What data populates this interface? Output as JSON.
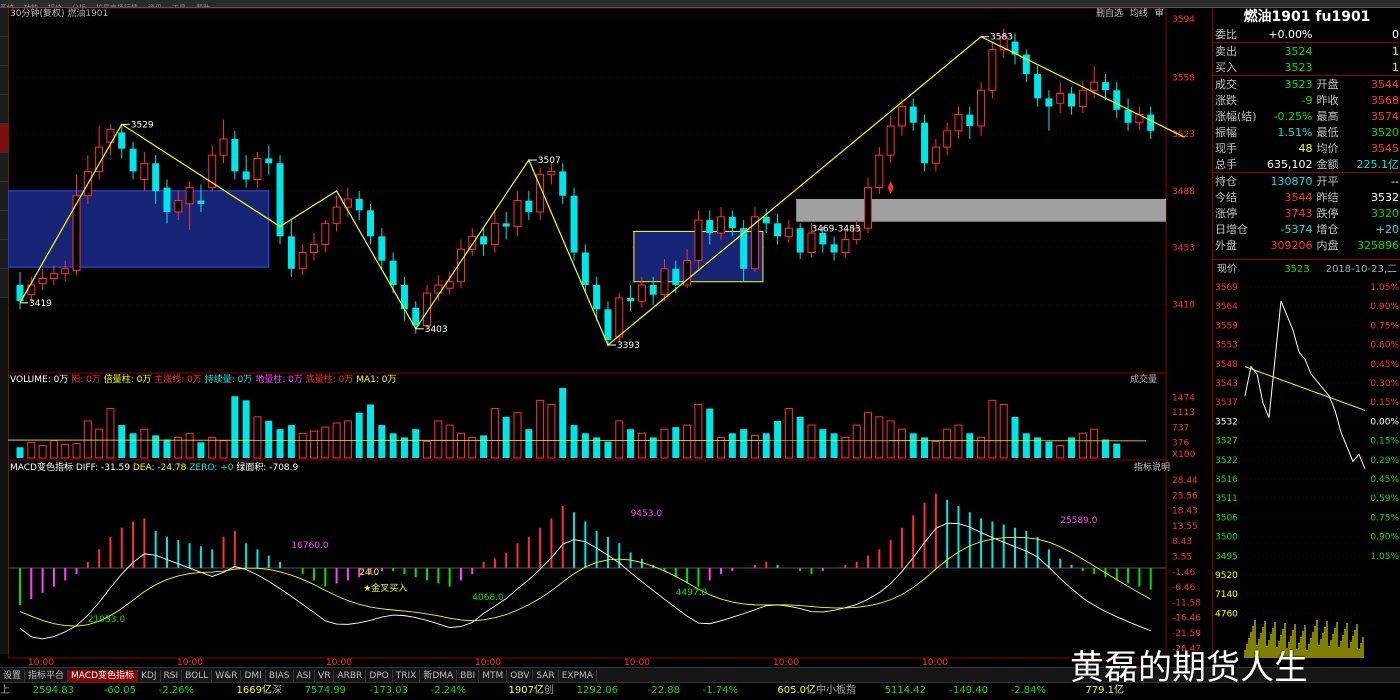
{
  "menubar": [
    "系统",
    "功能",
    "报价",
    "分析",
    "扩展市场行情",
    "资讯",
    "工具",
    "帮助"
  ],
  "chart_header": {
    "period": "30分钟(复权)",
    "name": "燃油1901"
  },
  "chart_top_buttons": [
    "删自选",
    "均线",
    "审"
  ],
  "colors": {
    "up": "#ff3030",
    "down": "#00e6e6",
    "box": "#1a2a8a",
    "trend": "#ffff00",
    "bg": "#000000"
  },
  "price_axis": [
    "3594",
    "3558",
    "3523",
    "3488",
    "3453",
    "3418"
  ],
  "annotations": {
    "peaks": [
      "3419",
      "3529",
      "3403",
      "3507",
      "3393",
      "3583"
    ],
    "range_label": "3469-3483"
  },
  "chart_data": [
    {
      "type": "candlestick",
      "title": "燃油1901 30分钟",
      "ylim": [
        3385,
        3597
      ],
      "yticks": [
        3594,
        3558,
        3523,
        3488,
        3453,
        3418
      ],
      "candles": [
        [
          3430,
          3420,
          3438,
          3415
        ],
        [
          3424,
          3430,
          3435,
          3419
        ],
        [
          3431,
          3434,
          3440,
          3427
        ],
        [
          3434,
          3437,
          3442,
          3430
        ],
        [
          3437,
          3440,
          3445,
          3432
        ],
        [
          3439,
          3485,
          3498,
          3436
        ],
        [
          3485,
          3500,
          3510,
          3480
        ],
        [
          3500,
          3515,
          3528,
          3495
        ],
        [
          3518,
          3526,
          3529,
          3510
        ],
        [
          3524,
          3514,
          3528,
          3508
        ],
        [
          3514,
          3500,
          3518,
          3495
        ],
        [
          3495,
          3505,
          3512,
          3488
        ],
        [
          3505,
          3488,
          3510,
          3480
        ],
        [
          3490,
          3475,
          3495,
          3468
        ],
        [
          3475,
          3482,
          3488,
          3470
        ],
        [
          3480,
          3490,
          3494,
          3464
        ],
        [
          3482,
          3480,
          3492,
          3475
        ],
        [
          3490,
          3510,
          3516,
          3488
        ],
        [
          3510,
          3520,
          3532,
          3505
        ],
        [
          3520,
          3500,
          3525,
          3495
        ],
        [
          3500,
          3495,
          3510,
          3490
        ],
        [
          3495,
          3508,
          3512,
          3490
        ],
        [
          3508,
          3505,
          3516,
          3498
        ],
        [
          3505,
          3460,
          3510,
          3455
        ],
        [
          3460,
          3440,
          3470,
          3435
        ],
        [
          3440,
          3450,
          3455,
          3436
        ],
        [
          3450,
          3455,
          3462,
          3445
        ],
        [
          3455,
          3468,
          3470,
          3450
        ],
        [
          3468,
          3478,
          3485,
          3463
        ],
        [
          3478,
          3483,
          3490,
          3472
        ],
        [
          3483,
          3476,
          3488,
          3470
        ],
        [
          3476,
          3460,
          3480,
          3455
        ],
        [
          3460,
          3445,
          3465,
          3440
        ],
        [
          3445,
          3430,
          3450,
          3425
        ],
        [
          3430,
          3415,
          3435,
          3408
        ],
        [
          3416,
          3405,
          3420,
          3400
        ],
        [
          3405,
          3425,
          3430,
          3402
        ],
        [
          3425,
          3430,
          3436,
          3420
        ],
        [
          3428,
          3432,
          3438,
          3424
        ],
        [
          3432,
          3452,
          3458,
          3428
        ],
        [
          3452,
          3460,
          3465,
          3448
        ],
        [
          3460,
          3455,
          3465,
          3448
        ],
        [
          3455,
          3468,
          3475,
          3450
        ],
        [
          3468,
          3466,
          3475,
          3458
        ],
        [
          3466,
          3482,
          3488,
          3460
        ],
        [
          3482,
          3475,
          3488,
          3470
        ],
        [
          3475,
          3498,
          3502,
          3470
        ],
        [
          3498,
          3500,
          3505,
          3492
        ],
        [
          3500,
          3485,
          3505,
          3480
        ],
        [
          3485,
          3450,
          3490,
          3445
        ],
        [
          3450,
          3430,
          3455,
          3425
        ],
        [
          3430,
          3415,
          3435,
          3408
        ],
        [
          3415,
          3396,
          3420,
          3392
        ],
        [
          3398,
          3422,
          3425,
          3395
        ],
        [
          3422,
          3420,
          3430,
          3414
        ],
        [
          3420,
          3430,
          3435,
          3416
        ],
        [
          3430,
          3424,
          3435,
          3418
        ],
        [
          3424,
          3440,
          3446,
          3420
        ],
        [
          3440,
          3430,
          3445,
          3425
        ],
        [
          3430,
          3445,
          3452,
          3428
        ],
        [
          3445,
          3470,
          3476,
          3440
        ],
        [
          3470,
          3462,
          3476,
          3455
        ],
        [
          3462,
          3472,
          3478,
          3458
        ],
        [
          3472,
          3465,
          3476,
          3460
        ],
        [
          3465,
          3440,
          3470,
          3432
        ],
        [
          3440,
          3472,
          3478,
          3438
        ],
        [
          3472,
          3468,
          3477,
          3462
        ],
        [
          3468,
          3460,
          3474,
          3455
        ],
        [
          3460,
          3465,
          3470,
          3456
        ],
        [
          3465,
          3450,
          3468,
          3446
        ],
        [
          3450,
          3462,
          3468,
          3447
        ],
        [
          3462,
          3455,
          3466,
          3450
        ],
        [
          3455,
          3450,
          3460,
          3445
        ],
        [
          3450,
          3458,
          3464,
          3447
        ],
        [
          3458,
          3465,
          3470,
          3455
        ],
        [
          3465,
          3490,
          3496,
          3462
        ],
        [
          3490,
          3510,
          3515,
          3486
        ],
        [
          3510,
          3528,
          3534,
          3505
        ],
        [
          3528,
          3540,
          3545,
          3522
        ],
        [
          3540,
          3530,
          3545,
          3525
        ],
        [
          3530,
          3505,
          3535,
          3500
        ],
        [
          3505,
          3515,
          3520,
          3500
        ],
        [
          3515,
          3525,
          3530,
          3510
        ],
        [
          3525,
          3535,
          3540,
          3520
        ],
        [
          3535,
          3528,
          3540,
          3520
        ],
        [
          3528,
          3550,
          3555,
          3522
        ],
        [
          3550,
          3575,
          3580,
          3545
        ],
        [
          3575,
          3583,
          3588,
          3570
        ],
        [
          3580,
          3572,
          3585,
          3566
        ],
        [
          3572,
          3560,
          3575,
          3555
        ],
        [
          3560,
          3545,
          3565,
          3540
        ],
        [
          3545,
          3540,
          3550,
          3525
        ],
        [
          3542,
          3548,
          3555,
          3536
        ],
        [
          3548,
          3540,
          3552,
          3535
        ],
        [
          3540,
          3550,
          3556,
          3536
        ],
        [
          3550,
          3555,
          3565,
          3545
        ],
        [
          3555,
          3550,
          3560,
          3544
        ],
        [
          3550,
          3538,
          3555,
          3533
        ],
        [
          3538,
          3530,
          3545,
          3525
        ],
        [
          3530,
          3535,
          3540,
          3526
        ],
        [
          3535,
          3525,
          3540,
          3520
        ]
      ]
    },
    {
      "type": "bar",
      "title": "VOLUME",
      "yticks": [
        "1474",
        "1113",
        "737",
        "376",
        "X100"
      ],
      "values": [
        260,
        380,
        300,
        420,
        330,
        350,
        900,
        700,
        1200,
        800,
        600,
        700,
        550,
        450,
        500,
        600,
        380,
        500,
        420,
        1500,
        1400,
        1000,
        900,
        700,
        800,
        600,
        650,
        750,
        850,
        900,
        1100,
        1300,
        800,
        600,
        500,
        700,
        400,
        900,
        800,
        600,
        500,
        550,
        1200,
        1000,
        1100,
        700,
        1400,
        1300,
        1700,
        800,
        600,
        500,
        400,
        900,
        700,
        600,
        500,
        700,
        750,
        800,
        1300,
        1200,
        500,
        600,
        700,
        550,
        600,
        900,
        1200,
        1000,
        800,
        700,
        600,
        500,
        800,
        1100,
        1000,
        900,
        700,
        600,
        500,
        400,
        700,
        800,
        600,
        500,
        1400,
        1300,
        1000,
        600,
        500,
        400,
        300,
        500,
        600,
        700,
        450,
        350
      ],
      "ma": 376
    },
    {
      "type": "bar",
      "title": "MACD",
      "yticks": [
        "28.44",
        "23.56",
        "18.43",
        "13.55",
        "8.43",
        "3.55",
        "-1.46",
        "-6.46",
        "-11.58",
        "-16.46",
        "-21.59",
        "-26.47"
      ],
      "values": [
        -12,
        -10,
        -8,
        -6,
        -4,
        -2,
        2,
        6,
        10,
        13,
        15,
        16,
        12,
        10,
        9,
        8,
        7,
        6,
        10,
        12,
        8,
        6,
        4,
        2,
        0,
        -2,
        -4,
        -6,
        -5,
        -4,
        -3,
        -2,
        -1,
        -1,
        -2,
        -3,
        -4,
        -5,
        -6,
        -4,
        -2,
        2,
        3,
        5,
        8,
        10,
        13,
        16,
        20,
        18,
        15,
        12,
        10,
        8,
        5,
        3,
        1,
        -1,
        -3,
        -5,
        -6,
        -4,
        -2,
        -1,
        0,
        1,
        2,
        1,
        0,
        -1,
        -2,
        -1,
        0,
        1,
        2,
        4,
        6,
        9,
        13,
        17,
        21,
        24,
        22,
        20,
        18,
        16,
        15,
        14,
        13,
        12,
        10,
        6,
        3,
        1,
        -1,
        -2,
        -3,
        -4,
        -5,
        -6,
        -7,
        -8,
        -9,
        -10
      ],
      "diff_label": "MACD变色指标 DIFF: -31.59",
      "dea_label": "DEA: -24.78",
      "zero_label": "ZERO: +0",
      "area_label": "绿面积: -708.9",
      "area_values": [
        "16760.0",
        "9453.0",
        "25589.0",
        "21933.0",
        "4068.0",
        "4497.0",
        "24.0"
      ]
    }
  ],
  "volume_header": [
    "VOLUME: 0万",
    "阳: 0万",
    "倍量柱: 0万",
    "主涨线: 0万",
    "持续量: 0万",
    "地量柱: 0万",
    "底量柱: 0万",
    "MA1: 0万"
  ],
  "volume_right": "成交量",
  "macd_right": "指标说明",
  "macd_note": "★金叉买入",
  "time_labels": [
    "10:00",
    "10:00",
    "10:00",
    "10:00",
    "10:00",
    "10:00",
    "10:00"
  ],
  "quote": {
    "title": "燃油1901 fu1901",
    "rows": [
      {
        "k": "委比",
        "v1": "+0.00%",
        "v2": "0",
        "c1": "white",
        "c2": "white"
      },
      {
        "k": "卖出",
        "v1": "3524",
        "v2": "1",
        "c1": "green",
        "c2": "yel"
      },
      {
        "k": "买入",
        "v1": "3523",
        "v2": "1",
        "c1": "green",
        "c2": "yel"
      },
      {
        "k": "成交",
        "v1": "3523",
        "k2": "开盘",
        "v2": "3544",
        "c1": "green",
        "c2": "red"
      },
      {
        "k": "涨跌",
        "v1": "-9",
        "k2": "昨收",
        "v2": "3568",
        "c1": "green",
        "c2": "red"
      },
      {
        "k": "涨幅(结)",
        "v1": "-0.25%",
        "k2": "最高",
        "v2": "3574",
        "c1": "green",
        "c2": "red"
      },
      {
        "k": "振幅",
        "v1": "1.51%",
        "k2": "最低",
        "v2": "3520",
        "c1": "cyan",
        "c2": "green"
      },
      {
        "k": "现手",
        "v1": "48",
        "k2": "均价",
        "v2": "3545",
        "c1": "yel",
        "c2": "red"
      },
      {
        "k": "总手",
        "v1": "635,102",
        "k2": "金额",
        "v2": "225.1亿",
        "c1": "white",
        "c2": "cyan"
      },
      {
        "k": "持仓",
        "v1": "130870",
        "k2": "开平",
        "v2": "--",
        "c1": "cyan",
        "c2": "white"
      },
      {
        "k": "今结",
        "v1": "3544",
        "k2": "昨结",
        "v2": "3532",
        "c1": "red",
        "c2": "white"
      },
      {
        "k": "涨停",
        "v1": "3743",
        "k2": "跌停",
        "v2": "3320",
        "c1": "red",
        "c2": "green"
      },
      {
        "k": "日增仓",
        "v1": "-5374",
        "k2": "增仓",
        "v2": "+20",
        "c1": "cyan",
        "c2": "cyan"
      },
      {
        "k": "外盘",
        "v1": "309206",
        "k2": "内盘",
        "v2": "325896",
        "c1": "red",
        "c2": "green"
      }
    ],
    "now_label": "现价",
    "now_value": "3523",
    "now_date": "2018-10-23,二",
    "mini_axis_left": [
      "3569",
      "3564",
      "3559",
      "3553",
      "3548",
      "3543",
      "3537",
      "3532",
      "3527",
      "3522",
      "3516",
      "3511",
      "3506",
      "3500",
      "3495",
      "9520",
      "7140",
      "4760"
    ],
    "mini_axis_right": [
      "1.05%",
      "0.90%",
      "0.75%",
      "0.60%",
      "0.45%",
      "0.30%",
      "0.15%",
      "0.00%",
      "0.15%",
      "0.29%",
      "0.45%",
      "0.59%",
      "0.75%",
      "0.90%",
      "1.05%"
    ]
  },
  "bottom_tabs": [
    "设置",
    "指标平台",
    "MACD变色指标",
    "KDJ",
    "RSI",
    "BOLL",
    "W&R",
    "DMI",
    "BIAS",
    "ASI",
    "VR",
    "ARBR",
    "DPO",
    "TRIX",
    "新DMA",
    "BBI",
    "MTM",
    "OBV",
    "SAR",
    "EXPMA"
  ],
  "status": [
    {
      "t": "上",
      "c": "gray"
    },
    {
      "t": "2594.83",
      "c": "green"
    },
    {
      "t": "-60.05",
      "c": "green"
    },
    {
      "t": "-2.26%",
      "c": "green"
    },
    {
      "t": "1669亿",
      "c": "yel"
    },
    {
      "t": "深",
      "c": "gray"
    },
    {
      "t": "7574.99",
      "c": "green"
    },
    {
      "t": "-173.03",
      "c": "green"
    },
    {
      "t": "-2.24%",
      "c": "green"
    },
    {
      "t": "1907亿",
      "c": "yel"
    },
    {
      "t": "创",
      "c": "gray"
    },
    {
      "t": "1292.06",
      "c": "green"
    },
    {
      "t": "-22.88",
      "c": "green"
    },
    {
      "t": "-1.74%",
      "c": "green"
    },
    {
      "t": "605.0亿",
      "c": "yel"
    },
    {
      "t": "中小板指",
      "c": "gray"
    },
    {
      "t": "5114.42",
      "c": "green"
    },
    {
      "t": "-149.40",
      "c": "green"
    },
    {
      "t": "-2.84%",
      "c": "green"
    },
    {
      "t": "779.1亿",
      "c": "yel"
    }
  ],
  "watermark": "黄磊的期货人生"
}
